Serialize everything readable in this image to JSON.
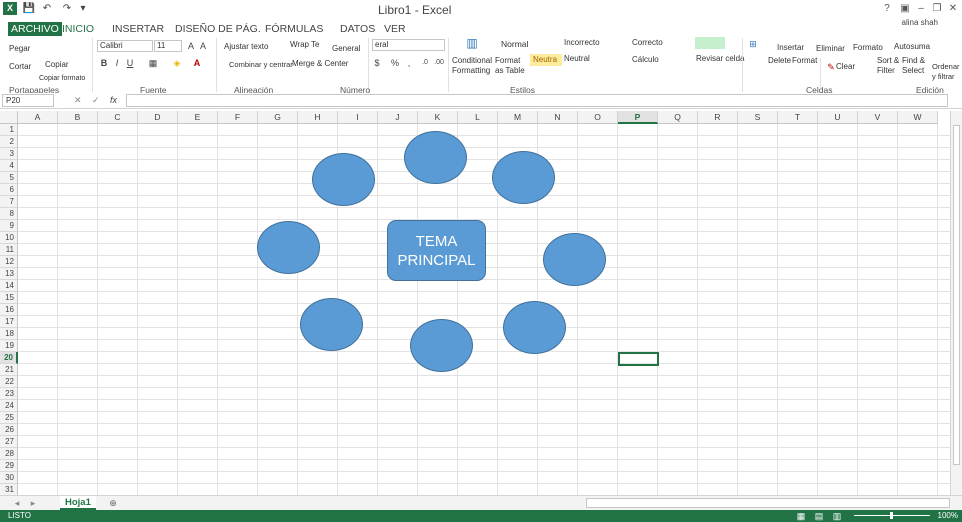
{
  "titlebar": {
    "app_icon": "X",
    "title": "Libro1 - Excel",
    "user": "alina shah",
    "help": "?",
    "minimize": "–",
    "restore": "❐",
    "close": "✕"
  },
  "tabs": [
    "ARCHIVO",
    "INICIO",
    "INSERTAR",
    "DISEÑO DE PÁG.",
    "FÓRMULAS",
    "DATOS",
    "VER"
  ],
  "ribbon": {
    "clipboard": {
      "paste": "Pegar",
      "cut": "Cortar",
      "copy": "Copiar",
      "copy_format": "Copiar formato",
      "label": "Portapapeles"
    },
    "font": {
      "name": "Calibri",
      "size": "11",
      "bold": "B",
      "italic": "I",
      "underline": "U",
      "label": "Fuente"
    },
    "alignment": {
      "wrap": "Ajustar texto",
      "wrap2": "Wrap Te",
      "merge": "Combinar y centrar",
      "merge2": "Merge & Center",
      "label": "Alineación"
    },
    "number": {
      "format": "General",
      "format2": "eral",
      "currency": "$",
      "percent": "%",
      "label": "Número"
    },
    "styles": {
      "conditional": "Conditional Formatting",
      "format_table": "Format as Table",
      "normal": "Normal",
      "incorrect": "Incorrecto",
      "correct": "Correcto",
      "neutral_es": "Neutra",
      "neutral": "Neutral",
      "calc": "Cálculo",
      "check": "Revisar celda",
      "label": "Estilos"
    },
    "cells": {
      "insert": "Insertar",
      "delete": "Delete",
      "format": "Format",
      "eliminar": "Eliminar",
      "formato": "Formato",
      "label": "Celdas"
    },
    "editing": {
      "autosum": "Autosuma",
      "clear": "Clear",
      "sort": "Sort & Filter",
      "find": "Find & Select",
      "sort_es": "Ordenar y filtrar",
      "label": "Edición"
    }
  },
  "formula_bar": {
    "name_box": "P20",
    "fx": "fx",
    "value": ""
  },
  "grid": {
    "columns": [
      "A",
      "B",
      "C",
      "D",
      "E",
      "F",
      "G",
      "H",
      "I",
      "J",
      "K",
      "L",
      "M",
      "N",
      "O",
      "P",
      "Q",
      "R",
      "S",
      "T",
      "U",
      "V",
      "W"
    ],
    "rows": [
      "1",
      "2",
      "3",
      "4",
      "5",
      "6",
      "7",
      "8",
      "9",
      "10",
      "11",
      "12",
      "13",
      "14",
      "15",
      "16",
      "17",
      "18",
      "19",
      "20",
      "21",
      "22",
      "23",
      "24",
      "25",
      "26",
      "27",
      "28",
      "29",
      "30",
      "31"
    ],
    "selected_column": "P",
    "selected_row": "20"
  },
  "diagram": {
    "main_topic": "TEMA\nPRINCIPAL",
    "shape_color": "#5b9bd5"
  },
  "sheets": [
    {
      "name": "Hoja1",
      "active": true
    }
  ],
  "status": {
    "ready": "LISTO",
    "zoom": "100%"
  }
}
